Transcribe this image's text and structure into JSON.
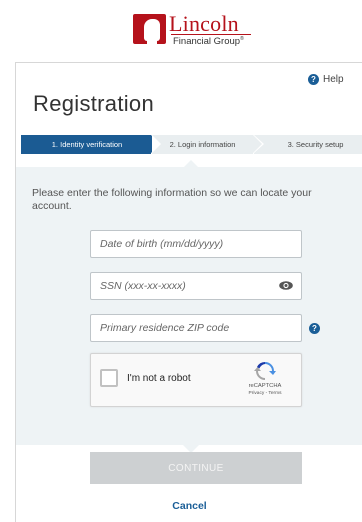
{
  "header": {
    "logo_name": "Lincoln",
    "logo_sub": "Financial Group",
    "logo_mark": "®"
  },
  "help": {
    "icon": "question-circle-icon",
    "label": "Help"
  },
  "page": {
    "title": "Registration"
  },
  "steps": [
    {
      "label": "1. Identity verification",
      "active": true
    },
    {
      "label": "2. Login information",
      "active": false
    },
    {
      "label": "3. Security setup",
      "active": false
    }
  ],
  "form": {
    "intro": "Please enter the following information so we can locate your account.",
    "dob": {
      "placeholder": "Date of birth (mm/dd/yyyy)",
      "value": ""
    },
    "ssn": {
      "placeholder": "SSN (xxx-xx-xxxx)",
      "value": ""
    },
    "zip": {
      "placeholder": "Primary residence ZIP code",
      "value": ""
    }
  },
  "captcha": {
    "label": "I'm not a robot",
    "brand": "reCAPTCHA",
    "links": "Privacy - Terms"
  },
  "actions": {
    "continue_label": "CONTINUE",
    "cancel_label": "Cancel"
  },
  "colors": {
    "brand_red": "#b5121b",
    "step_active": "#1b5b93",
    "link_blue": "#1a5e97",
    "panel_bg": "#eef3f5",
    "button_disabled": "#cdd0d2"
  }
}
